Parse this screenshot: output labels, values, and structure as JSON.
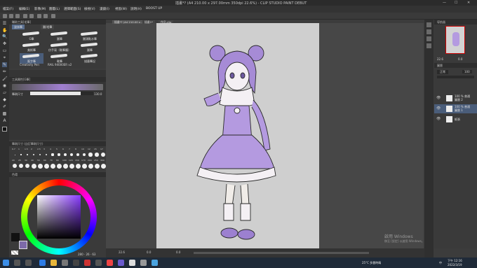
{
  "window": {
    "title": "插畫*? (A4 210.00 x 297.00mm 350dpi 22.6%) - CLIP STUDIO PAINT DEBUT",
    "minimize": "—",
    "maximize": "☐",
    "close": "✕"
  },
  "menu": [
    "檔案(F)",
    "編輯(E)",
    "影像(M)",
    "圖層(L)",
    "選擇範圍(S)",
    "檢視(V)",
    "濾鏡(I)",
    "視窗(W)",
    "說明(H)",
    "BOOST UP"
  ],
  "tools": [
    "☰",
    "✋",
    "🔍",
    "✥",
    "▭",
    "⌖",
    "✎",
    "✏",
    "🖌",
    "◉",
    "▱",
    "◆",
    "✐",
    "▩",
    "A",
    "◼"
  ],
  "brush_panel": {
    "header": "輔助工具[毛筆]",
    "tabs": [
      "塗抹筆",
      "圓/毛筆"
    ],
    "brushes": [
      "G筆",
      "圓筆",
      "圓頭點水筆",
      "美術筆",
      "仿手寫（軟筆觸）",
      "圓筆",
      "簽字筆",
      "軟筆",
      "描墨筆記",
      "Creativity Pen",
      "RAIL 94000ER v2"
    ]
  },
  "tool_property": {
    "header": "工具屬性[G筆]",
    "label_size": "筆刷尺寸",
    "size_value": "130.0"
  },
  "brush_size_panel": {
    "header": "筆刷尺寸 (自訂筆刷尺寸)",
    "sizes": [
      "0.7",
      "1",
      "1.5",
      "2",
      "2.5",
      "3",
      "4",
      "5",
      "6",
      "7",
      "8",
      "10",
      "12",
      "15",
      "17",
      "20",
      "25",
      "30",
      "40",
      "50",
      "60",
      "70",
      "80",
      "100",
      "120",
      "150",
      "170",
      "200",
      "250",
      "300"
    ]
  },
  "color_panel": {
    "header": "色環",
    "hsv_readout": "280 · 26 · 63",
    "main_color": "#7d6aa8",
    "sub_color": "#111111"
  },
  "document_tabs": [
    "插畫*? (A4 210.00 x ...)",
    "插畫1*",
    "作品.clip"
  ],
  "status": {
    "zoom": "22.6",
    "angle": "0.0",
    "position": "0.0"
  },
  "navigator": {
    "header": "導航器",
    "zoom": "22.6",
    "angle": "0.0"
  },
  "layer_panel": {
    "header": "圖層",
    "blend_mode": "正常",
    "opacity": "100",
    "layers": [
      {
        "name": "100 % 普通",
        "sub": "圖層 2",
        "selected": false
      },
      {
        "name": "100 % 普通",
        "sub": "圖層 1",
        "selected": true
      },
      {
        "name": "紙張",
        "sub": "",
        "selected": false
      }
    ]
  },
  "watermark": {
    "line1": "啟用 Windows",
    "line2": "移至 [設定] 以啟用 Windows。"
  },
  "taskbar": {
    "weather": "25°C 多雲時晴",
    "time": "下午 12:16",
    "date": "2022/3/19",
    "lang": "中"
  },
  "colors": {
    "accent_purple": "#a07fd0",
    "selected_layer": "#4a5d7a",
    "active_tab": "#5a6f8f"
  }
}
